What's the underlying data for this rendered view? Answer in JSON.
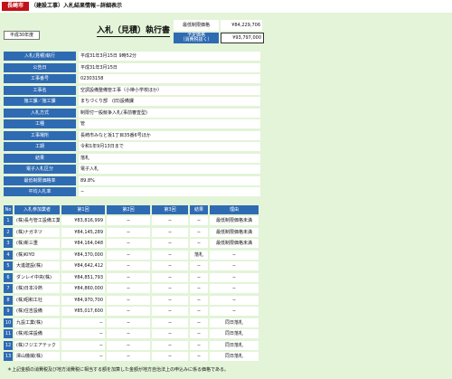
{
  "header": {
    "city": "長崎市",
    "title": "（建設工事）入札結果情報−詳細表示"
  },
  "fiscal_year": "平成30年度",
  "page_title": "入札（見積）執行書",
  "prices": [
    {
      "label": "最低制限価格",
      "value": "¥84,229,706"
    },
    {
      "label": "予定価格\n（消費税抜く）",
      "value": "¥93,797,000"
    }
  ],
  "info": [
    {
      "k": "入札(見積)執行",
      "v": "平成31年3月15日 9時52分"
    },
    {
      "k": "公告日",
      "v": "平成31年3月15日"
    },
    {
      "k": "工事番号",
      "v": "02303158"
    },
    {
      "k": "工事名",
      "v": "空調設備整備管工事（小榊小学校ほか）"
    },
    {
      "k": "施工課／施工課",
      "v": "まちづくり部　(旧)設備課"
    },
    {
      "k": "入札方式",
      "v": "制限付一般競争入札(事前審査型)"
    },
    {
      "k": "工種",
      "v": "管"
    },
    {
      "k": "工事場所",
      "v": "長崎市みなと坂1丁目35番6号ほか"
    },
    {
      "k": "工期",
      "v": "令和1年9月13日まで"
    },
    {
      "k": "結果",
      "v": "落札"
    },
    {
      "k": "電子入札区分",
      "v": "電子入札"
    },
    {
      "k": "最低制限価格率",
      "v": "89.8%"
    },
    {
      "k": "平均入札率",
      "v": "−"
    }
  ],
  "bid_table": {
    "headers": [
      "No",
      "入札参加業者",
      "第1回",
      "第2回",
      "第3回",
      "結果",
      "理由"
    ],
    "rows": [
      {
        "no": "1",
        "name": "(株)長与管工設備工業所",
        "r1": "¥83,816,999",
        "r2": "−",
        "r3": "−",
        "result": "−",
        "reason": "最低制限価格未満"
      },
      {
        "no": "2",
        "name": "(株)ナガネツ",
        "r1": "¥84,145,289",
        "r2": "−",
        "r3": "−",
        "result": "−",
        "reason": "最低制限価格未満"
      },
      {
        "no": "3",
        "name": "(株)新三重",
        "r1": "¥84,164,048",
        "r2": "−",
        "r3": "−",
        "result": "−",
        "reason": "最低制限価格未満"
      },
      {
        "no": "4",
        "name": "(株)KIYO",
        "r1": "¥84,370,000",
        "r2": "−",
        "r3": "−",
        "result": "落札",
        "reason": "−"
      },
      {
        "no": "5",
        "name": "大進建設(株)",
        "r1": "¥84,642,412",
        "r2": "−",
        "r3": "−",
        "result": "−",
        "reason": "−"
      },
      {
        "no": "6",
        "name": "ダンレイ中央(株)",
        "r1": "¥84,851,793",
        "r2": "−",
        "r3": "−",
        "result": "−",
        "reason": "−"
      },
      {
        "no": "7",
        "name": "(株)日本冷熱",
        "r1": "¥84,860,000",
        "r2": "−",
        "r3": "−",
        "result": "−",
        "reason": "−"
      },
      {
        "no": "8",
        "name": "(株)昭和工社",
        "r1": "¥84,970,700",
        "r2": "−",
        "r3": "−",
        "result": "−",
        "reason": "−"
      },
      {
        "no": "9",
        "name": "(株)住吉設備",
        "r1": "¥85,017,600",
        "r2": "−",
        "r3": "−",
        "result": "−",
        "reason": "−"
      },
      {
        "no": "10",
        "name": "九設工業(株)",
        "r1": "−",
        "r2": "−",
        "r3": "−",
        "result": "−",
        "reason": "同日落札"
      },
      {
        "no": "11",
        "name": "(株)松栄設備",
        "r1": "−",
        "r2": "−",
        "r3": "−",
        "result": "−",
        "reason": "同日落札"
      },
      {
        "no": "12",
        "name": "(株)フジエアテック",
        "r1": "−",
        "r2": "−",
        "r3": "−",
        "result": "−",
        "reason": "同日落札"
      },
      {
        "no": "13",
        "name": "澤山機械(株)",
        "r1": "−",
        "r2": "−",
        "r3": "−",
        "result": "−",
        "reason": "同日落札"
      }
    ]
  },
  "note": "＊上記金額の消費税及び地方消費税に相当する額を加算した金額が地方自治法上の申込みに係る価格である。",
  "colors": {
    "accent": "#2f6bb3",
    "brand": "#c01217",
    "background": "#e3f4d8"
  }
}
